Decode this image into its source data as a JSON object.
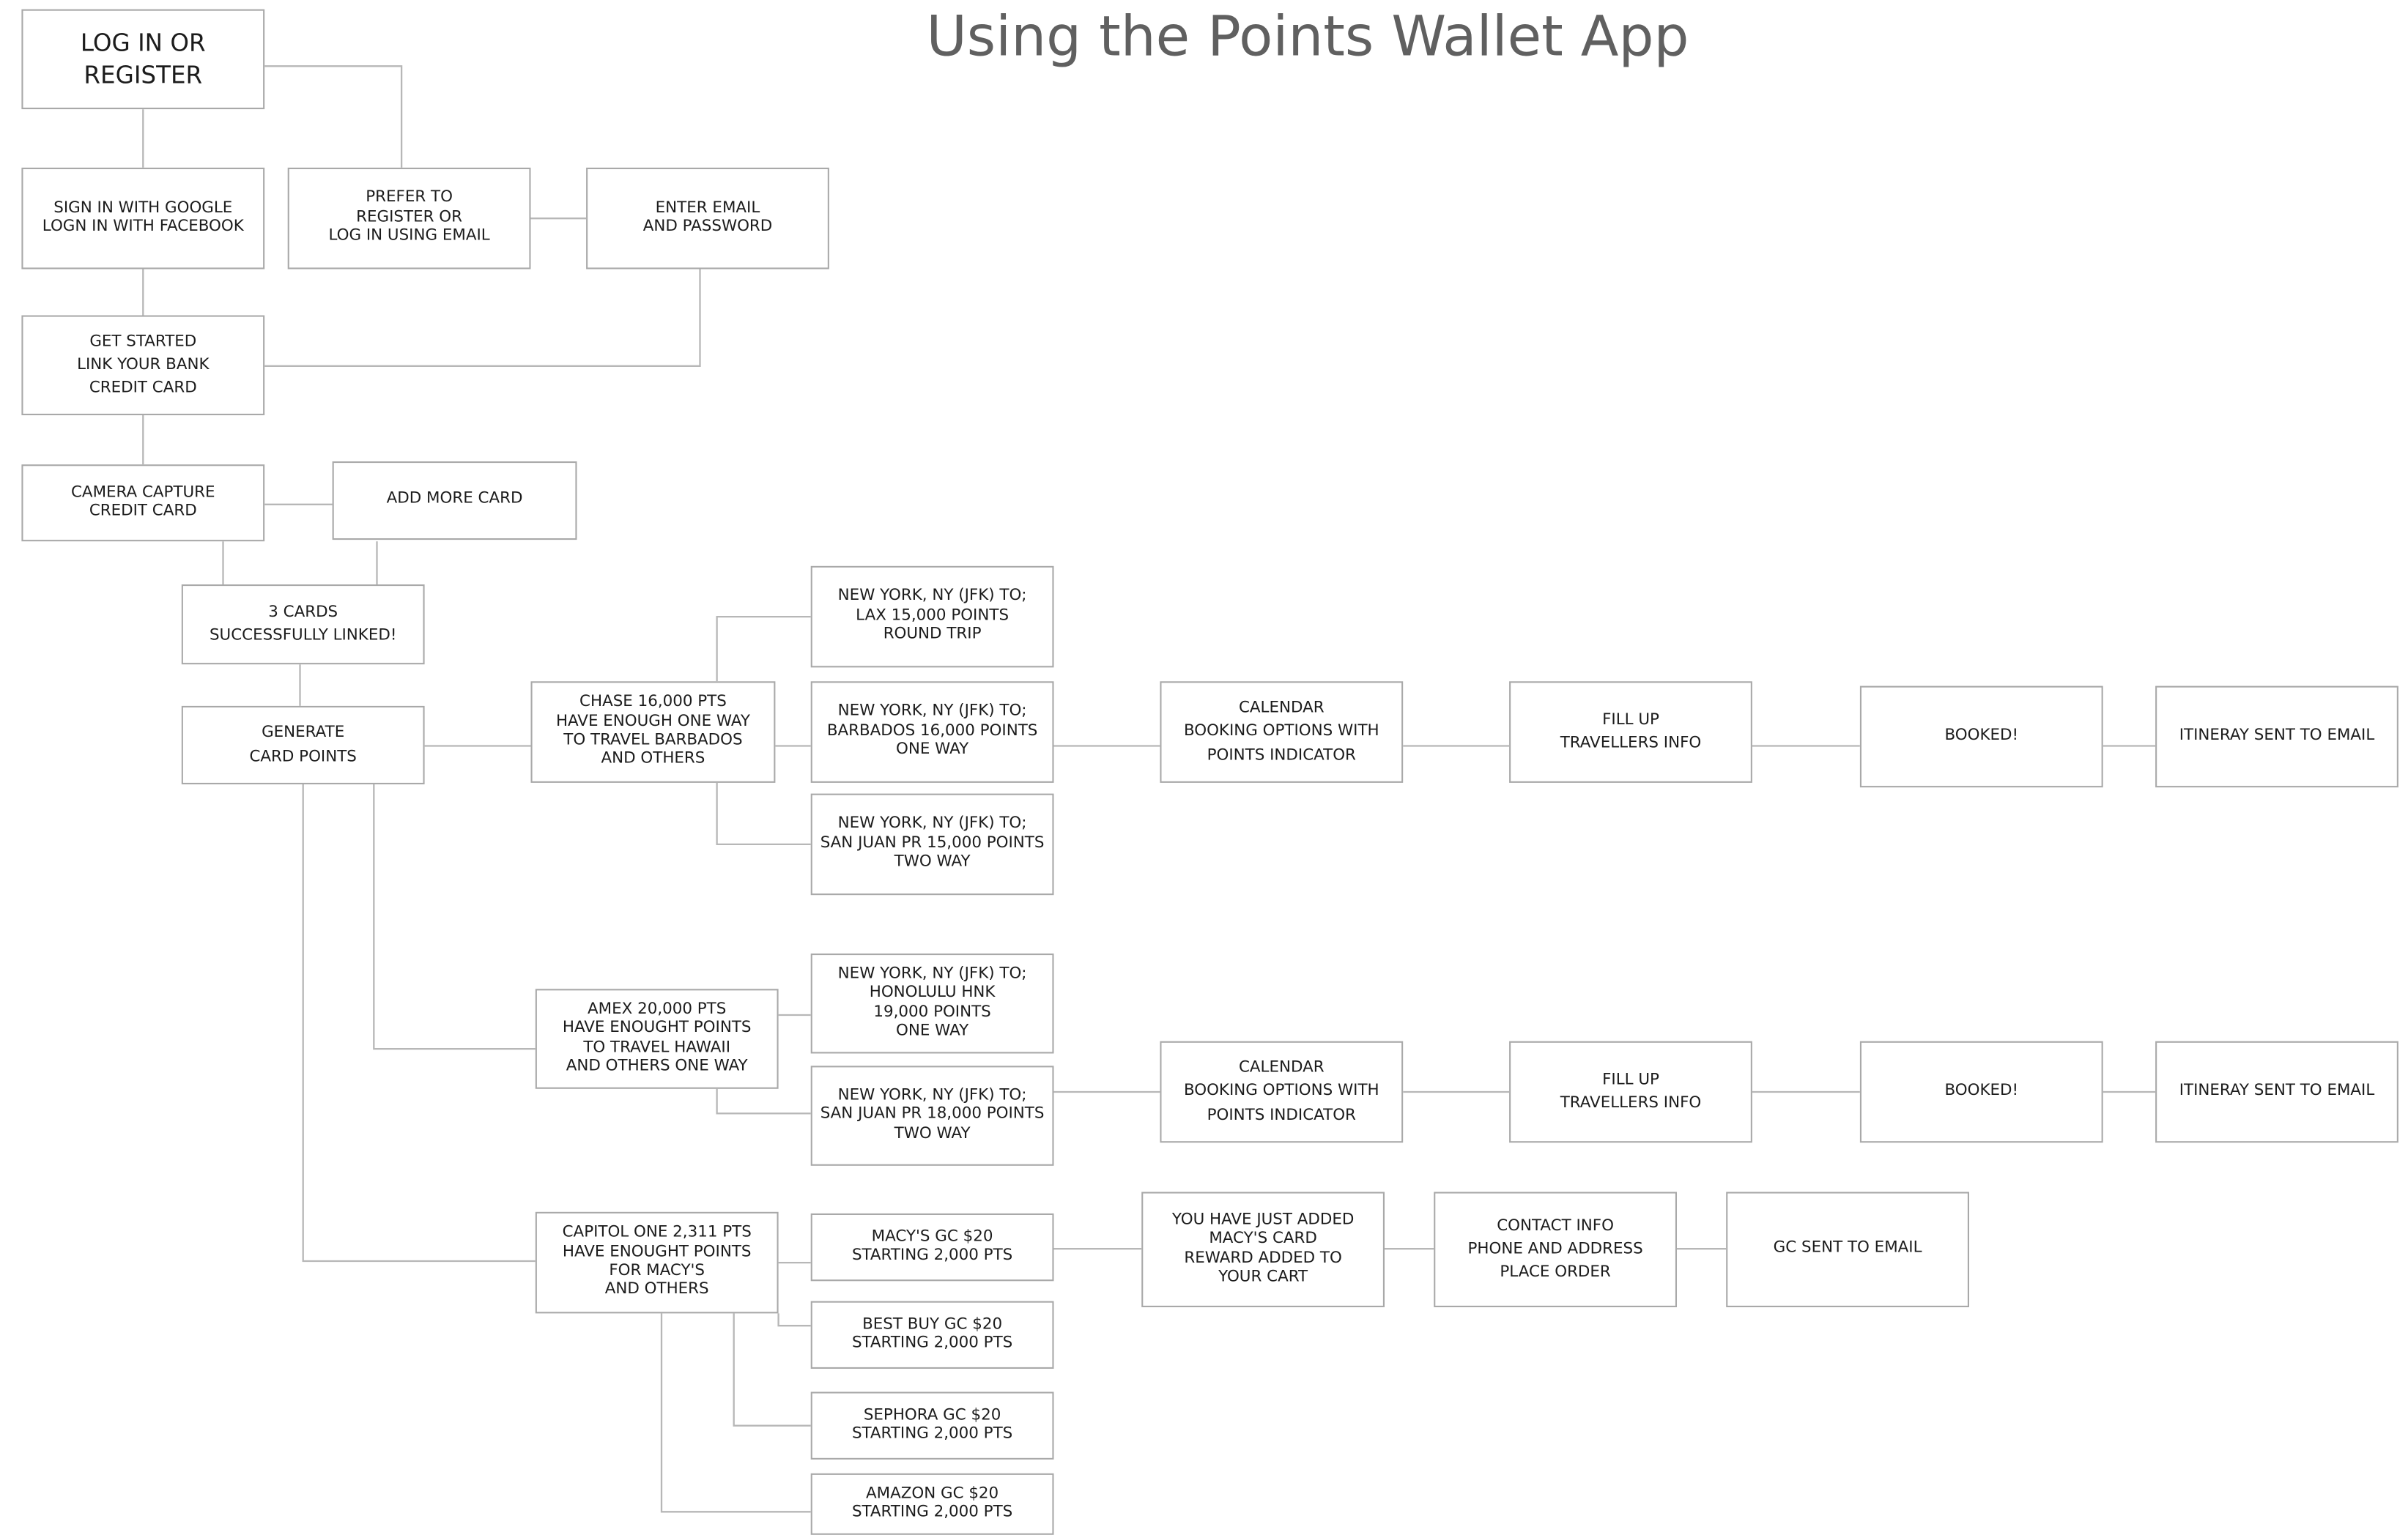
{
  "title": "Using the Points Wallet App",
  "nodes": {
    "login": "LOG IN OR\nREGISTER",
    "social": "SIGN IN WITH GOOGLE\nLOGN IN WITH FACEBOOK",
    "prefer": "PREFER TO\nREGISTER OR\nLOG IN USING EMAIL",
    "email": "ENTER EMAIL\nAND PASSWORD",
    "getstarted": "GET STARTED\nLINK YOUR BANK\nCREDIT CARD",
    "camera": "CAMERA CAPTURE\nCREDIT CARD",
    "addmore": "ADD MORE CARD",
    "linked": "3 CARDS\nSUCCESSFULLY LINKED!",
    "generate": "GENERATE\nCARD POINTS",
    "chase": "CHASE 16,000 PTS\nHAVE ENOUGH ONE WAY\nTO TRAVEL BARBADOS\nAND OTHERS",
    "lax": "NEW YORK, NY (JFK) TO;\nLAX 15,000 POINTS\nROUND TRIP",
    "barbados": "NEW YORK, NY (JFK) TO;\nBARBADOS 16,000 POINTS\nONE WAY",
    "sanjuan1": "NEW YORK, NY (JFK) TO;\nSAN JUAN PR 15,000 POINTS\nTWO WAY",
    "cal1": "CALENDAR\nBOOKING OPTIONS WITH\nPOINTS INDICATOR",
    "fill1": "FILL UP\nTRAVELLERS INFO",
    "booked1": "BOOKED!",
    "itin1": "ITINERAY SENT TO EMAIL",
    "amex": "AMEX 20,000 PTS\nHAVE ENOUGHT POINTS\nTO TRAVEL HAWAII\nAND OTHERS ONE WAY",
    "honolulu": "NEW YORK, NY (JFK) TO;\nHONOLULU HNK\n19,000 POINTS\nONE WAY",
    "sanjuan2": "NEW YORK, NY (JFK) TO;\nSAN JUAN PR 18,000 POINTS\nTWO WAY",
    "cal2": "CALENDAR\nBOOKING OPTIONS WITH\nPOINTS INDICATOR",
    "fill2": "FILL UP\nTRAVELLERS INFO",
    "booked2": "BOOKED!",
    "itin2": "ITINERAY SENT TO EMAIL",
    "capitol": "CAPITOL ONE 2,311 PTS\nHAVE ENOUGHT POINTS\nFOR MACY'S\nAND OTHERS",
    "macys": "MACY'S GC $20\nSTARTING 2,000 PTS",
    "bestbuy": "BEST BUY GC $20\nSTARTING 2,000 PTS",
    "sephora": "SEPHORA GC $20\nSTARTING 2,000 PTS",
    "amazon": "AMAZON GC $20\nSTARTING 2,000 PTS",
    "added": "YOU HAVE JUST ADDED\nMACY'S CARD\nREWARD ADDED TO\nYOUR CART",
    "contact": "CONTACT INFO\nPHONE AND ADDRESS\nPLACE ORDER",
    "gcsent": "GC SENT TO EMAIL"
  }
}
